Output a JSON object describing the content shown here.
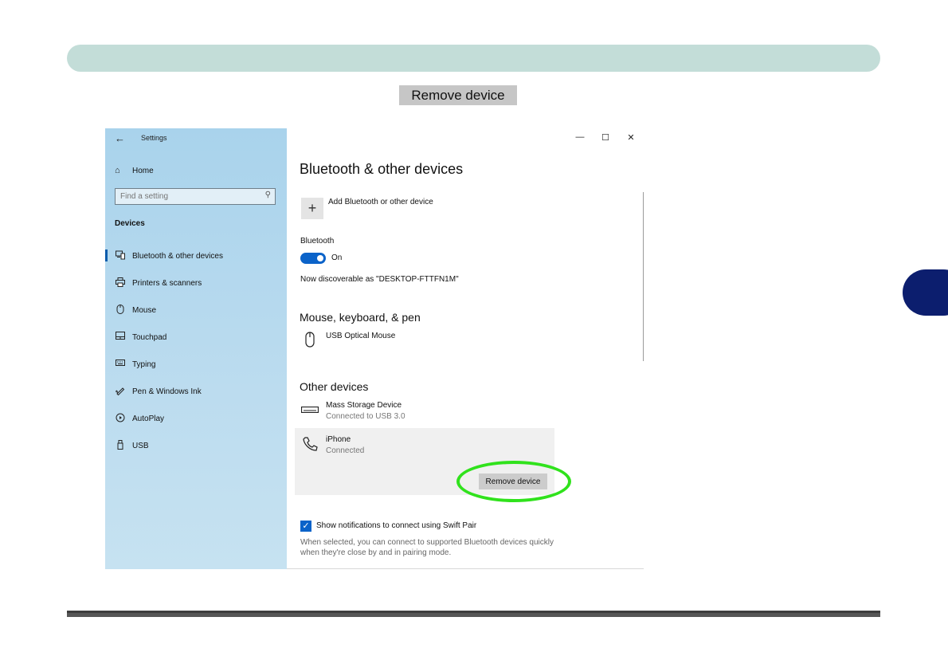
{
  "caption": "Remove device",
  "window": {
    "title": "Settings",
    "controls": {
      "minimize": "—",
      "maximize": "☐",
      "close": "✕"
    }
  },
  "sidebar": {
    "home": "Home",
    "search_placeholder": "Find a setting",
    "section": "Devices",
    "items": [
      {
        "label": "Bluetooth & other devices",
        "icon": "bluetooth-devices-icon",
        "active": true
      },
      {
        "label": "Printers & scanners",
        "icon": "printer-icon"
      },
      {
        "label": "Mouse",
        "icon": "mouse-icon"
      },
      {
        "label": "Touchpad",
        "icon": "touchpad-icon"
      },
      {
        "label": "Typing",
        "icon": "keyboard-icon"
      },
      {
        "label": "Pen & Windows Ink",
        "icon": "pen-icon"
      },
      {
        "label": "AutoPlay",
        "icon": "autoplay-icon"
      },
      {
        "label": "USB",
        "icon": "usb-icon"
      }
    ]
  },
  "main": {
    "title": "Bluetooth & other devices",
    "add_device": "Add Bluetooth or other device",
    "bluetooth_label": "Bluetooth",
    "bluetooth_state": "On",
    "discoverable": "Now discoverable as \"DESKTOP-FTTFN1M\"",
    "mouse_section": "Mouse, keyboard, & pen",
    "mouse_device": "USB Optical Mouse",
    "other_section": "Other devices",
    "mass_storage_name": "Mass Storage Device",
    "mass_storage_status": "Connected to USB 3.0",
    "iphone_name": "iPhone",
    "iphone_status": "Connected",
    "remove_button": "Remove device",
    "swift_pair_label": "Show notifications to connect using Swift Pair",
    "swift_pair_help": "When selected, you can connect to supported Bluetooth devices quickly when they're close by and in pairing mode."
  },
  "colors": {
    "accent": "#0b63c9",
    "highlight": "#30e21c",
    "header_bar": "#c3ddd8",
    "side_tab": "#0c1e6e"
  }
}
